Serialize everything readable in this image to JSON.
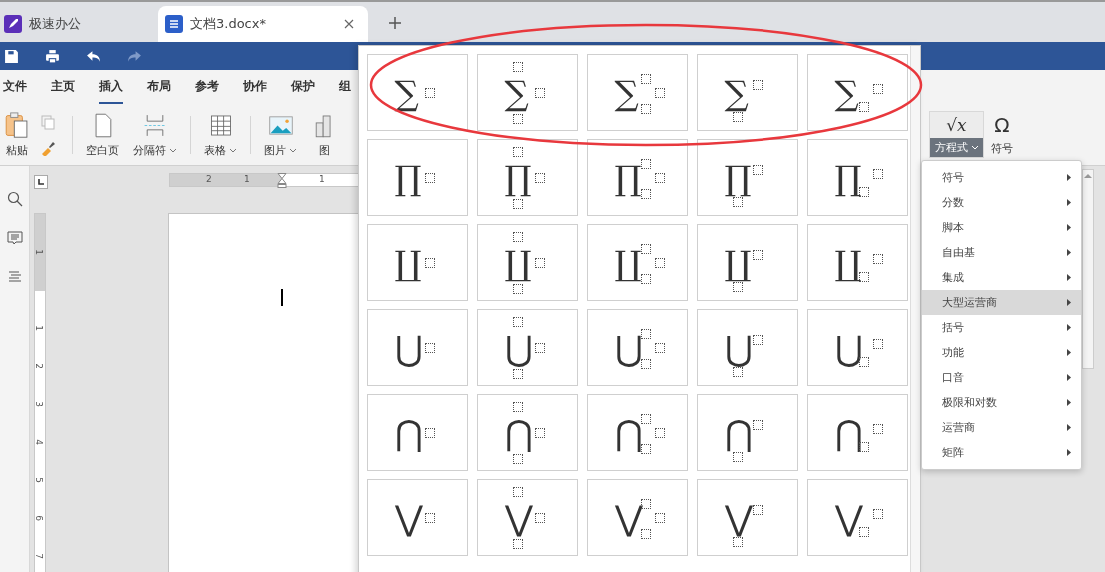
{
  "tabs": [
    {
      "label": "极速办公",
      "kind": "app",
      "selected": false
    },
    {
      "label": "文档3.docx*",
      "kind": "doc",
      "selected": true
    }
  ],
  "menu": [
    {
      "label": "文件",
      "selected": false
    },
    {
      "label": "主页",
      "selected": false
    },
    {
      "label": "插入",
      "selected": true
    },
    {
      "label": "布局",
      "selected": false
    },
    {
      "label": "参考",
      "selected": false
    },
    {
      "label": "协作",
      "selected": false
    },
    {
      "label": "保护",
      "selected": false
    },
    {
      "label": "组",
      "selected": false
    }
  ],
  "ribbon": {
    "paste": "粘贴",
    "groups": [
      {
        "label": "空白页",
        "kind": "page",
        "dropdown": false
      },
      {
        "label": "分隔符",
        "kind": "break",
        "dropdown": true
      },
      {
        "label": "表格",
        "kind": "table",
        "dropdown": true
      },
      {
        "label": "图片",
        "kind": "image",
        "dropdown": true
      },
      {
        "label": "图",
        "kind": "chart",
        "dropdown": false
      }
    ],
    "equation": {
      "icon": "√x",
      "label": "方程式",
      "selected": true
    },
    "symbol": {
      "icon": "Ω",
      "label": "符号"
    }
  },
  "ruler": {
    "horizontal": [
      "2",
      "1",
      "1"
    ],
    "vertical": [
      "1",
      "1",
      "2",
      "3",
      "4",
      "5",
      "6",
      "7"
    ]
  },
  "equation_menu": [
    {
      "label": "符号",
      "selected": false
    },
    {
      "label": "分数",
      "selected": false
    },
    {
      "label": "脚本",
      "selected": false
    },
    {
      "label": "自由基",
      "selected": false
    },
    {
      "label": "集成",
      "selected": false
    },
    {
      "label": "大型运营商",
      "selected": true
    },
    {
      "label": "括号",
      "selected": false
    },
    {
      "label": "功能",
      "selected": false
    },
    {
      "label": "口音",
      "selected": false
    },
    {
      "label": "极限和对数",
      "selected": false
    },
    {
      "label": "运营商",
      "selected": false
    },
    {
      "label": "矩阵",
      "selected": false
    }
  ],
  "palette": [
    {
      "cells": [
        {
          "symbol": "∑",
          "kind": "plain"
        },
        {
          "symbol": "∑",
          "kind": "limits"
        },
        {
          "symbol": "∑",
          "kind": "subsup"
        },
        {
          "symbol": "∑",
          "kind": "under"
        },
        {
          "symbol": "∑",
          "kind": "sub"
        }
      ]
    },
    {
      "cells": [
        {
          "symbol": "∏",
          "kind": "plain"
        },
        {
          "symbol": "∏",
          "kind": "limits"
        },
        {
          "symbol": "∏",
          "kind": "subsup"
        },
        {
          "symbol": "∏",
          "kind": "under"
        },
        {
          "symbol": "∏",
          "kind": "sub"
        }
      ]
    },
    {
      "cells": [
        {
          "symbol": "∐",
          "kind": "plain"
        },
        {
          "symbol": "∐",
          "kind": "limits"
        },
        {
          "symbol": "∐",
          "kind": "subsup"
        },
        {
          "symbol": "∐",
          "kind": "under"
        },
        {
          "symbol": "∐",
          "kind": "sub"
        }
      ]
    },
    {
      "cells": [
        {
          "symbol": "⋃",
          "kind": "plain"
        },
        {
          "symbol": "⋃",
          "kind": "limits"
        },
        {
          "symbol": "⋃",
          "kind": "subsup"
        },
        {
          "symbol": "⋃",
          "kind": "under"
        },
        {
          "symbol": "⋃",
          "kind": "sub"
        }
      ]
    },
    {
      "cells": [
        {
          "symbol": "⋂",
          "kind": "plain"
        },
        {
          "symbol": "⋂",
          "kind": "limits"
        },
        {
          "symbol": "⋂",
          "kind": "subsup"
        },
        {
          "symbol": "⋂",
          "kind": "under"
        },
        {
          "symbol": "⋂",
          "kind": "sub"
        }
      ]
    },
    {
      "cells": [
        {
          "symbol": "⋁",
          "kind": "plain"
        },
        {
          "symbol": "⋁",
          "kind": "limits"
        },
        {
          "symbol": "⋁",
          "kind": "subsup"
        },
        {
          "symbol": "⋁",
          "kind": "under"
        },
        {
          "symbol": "⋁",
          "kind": "sub"
        }
      ]
    }
  ]
}
